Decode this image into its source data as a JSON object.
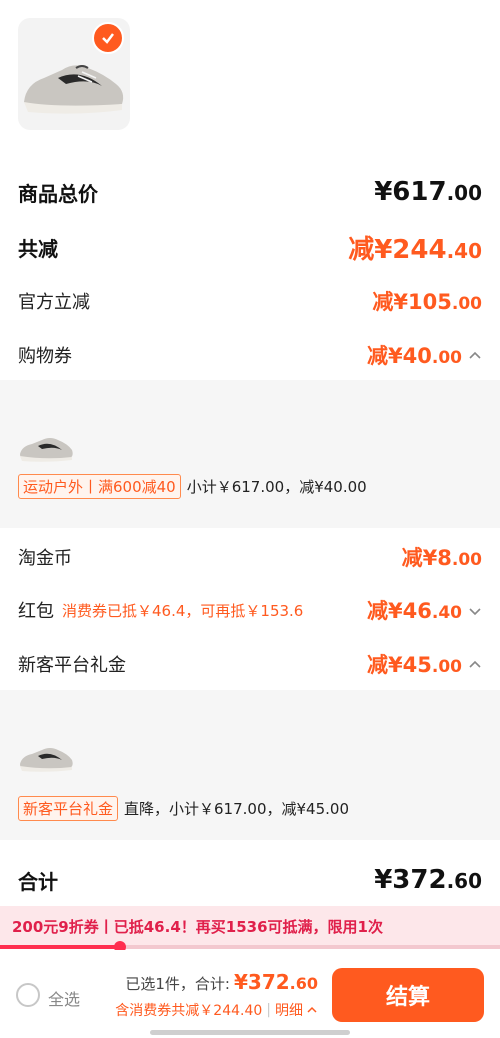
{
  "product": {
    "image": "running-shoe-image",
    "selected": true
  },
  "summary": {
    "total_label": "商品总价",
    "total_big": "¥617",
    "total_dec": ".00",
    "discount_label": "共减",
    "discount_big": "减¥244",
    "discount_dec": ".40",
    "official_label": "官方立减",
    "official_big": "减¥105",
    "official_dec": ".00",
    "coupon_label": "购物券",
    "coupon_big": "减¥40",
    "coupon_dec": ".00"
  },
  "coupon_panel": {
    "tag": "运动户外丨满600减40",
    "note": "小计￥617.00，减¥40.00"
  },
  "taojinbi": {
    "label": "淘金币",
    "big": "减¥8",
    "dec": ".00"
  },
  "hongbao": {
    "label": "红包",
    "note": "消费券已抵￥46.4，可再抵￥153.6",
    "big": "减¥46",
    "dec": ".40"
  },
  "newuser": {
    "label": "新客平台礼金",
    "big": "减¥45",
    "dec": ".00"
  },
  "newuser_panel": {
    "tag": "新客平台礼金",
    "note": "直降，小计￥617.00，减¥45.00"
  },
  "grand": {
    "label": "合计",
    "big": "¥372",
    "dec": ".60"
  },
  "promo": {
    "text": "200元9折券丨已抵46.4！再买1536可抵满，限用1次",
    "progress": 0.24
  },
  "bottom": {
    "select_all": "全选",
    "selected_text": "已选1件，合计:",
    "total_big": "¥372",
    "total_dec": ".60",
    "sub_text": "含消费券共减￥244.40",
    "detail": "明细",
    "checkout": "结算"
  },
  "colors": {
    "accent": "#ff5a1f",
    "promo": "#e0204b"
  }
}
